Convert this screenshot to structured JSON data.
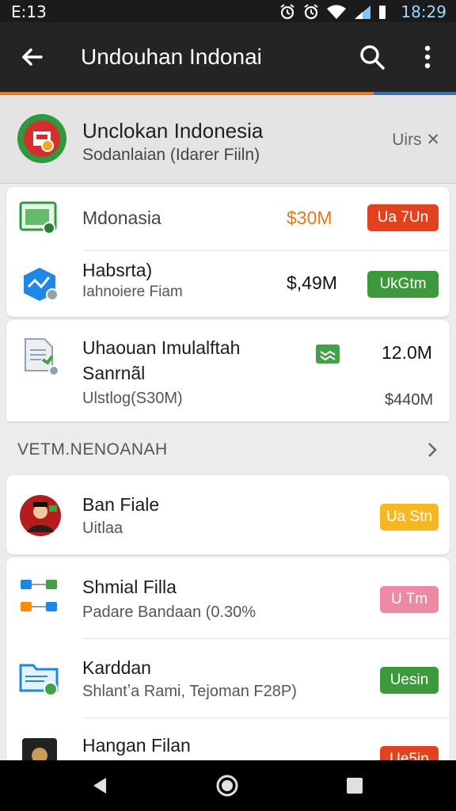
{
  "status_bar": {
    "time": "E:13",
    "clock": "18:29"
  },
  "toolbar": {
    "title": "Undouhan Indonai"
  },
  "progress": {
    "fraction": 0.82
  },
  "header": {
    "title": "Unclokan Indonesia",
    "subtitle": "Sodanlaian (Idarer Fiiln)",
    "action": "Uirs ✕"
  },
  "card1": {
    "items": [
      {
        "name": "Mdonasia",
        "amount": "$30M",
        "button": "Ua 7Un",
        "amount_color": "#e07a1c",
        "button_color": "#e2421e"
      },
      {
        "name": "Habsrta)",
        "sub": "Iahnoiere Fiam",
        "amount": "$,49M",
        "button": "UkGtm",
        "amount_color": "#111111",
        "button_color": "#3c9a3c"
      }
    ]
  },
  "card2": {
    "title_line1": "Uhaouan Imulalftah",
    "title_line2": "Sanrnãl",
    "sub": "Ulstlog(S30M)",
    "amount": "12.0M",
    "amount2": "$440M"
  },
  "section": {
    "title": "VETM.NENOANAH"
  },
  "list": [
    {
      "name": "Ban Fiale",
      "sub": "Uitlaa",
      "button": "Ua Stn",
      "button_color": "#f5b820"
    },
    {
      "name": "Shmial Filla",
      "sub": "Padare Bandaan (0.30%",
      "button": "U Tm",
      "button_color": "#ec8aa4"
    },
    {
      "name": "Karddan",
      "sub": "Shlantʼa Rami, Tejoman F28P)",
      "button": "Uesin",
      "button_color": "#3c9a3c"
    },
    {
      "name": "Hangan Filan",
      "button": "Ue5in",
      "button_color": "#e2421e"
    }
  ]
}
